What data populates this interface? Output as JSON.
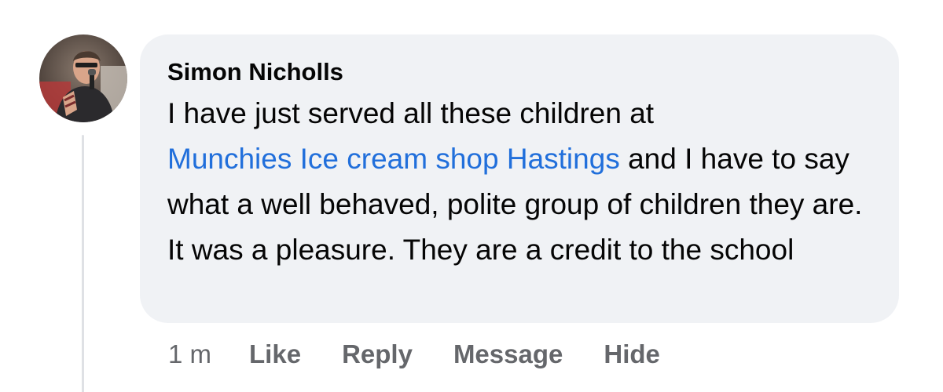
{
  "comment": {
    "author": "Simon Nicholls",
    "text_before_link": "I have just served all these children at",
    "link_text": "Munchies Ice cream shop Hastings",
    "text_after_link": " and I have to say what a well behaved, polite group of children they are. It was a pleasure. They are a credit to the school",
    "avatar": "profile-photo"
  },
  "actions": {
    "timestamp": "1 m",
    "like": "Like",
    "reply": "Reply",
    "message": "Message",
    "hide": "Hide"
  },
  "colors": {
    "bubble": "#f0f2f5",
    "link": "#216fdb",
    "meta": "#65676b",
    "text": "#050505"
  }
}
